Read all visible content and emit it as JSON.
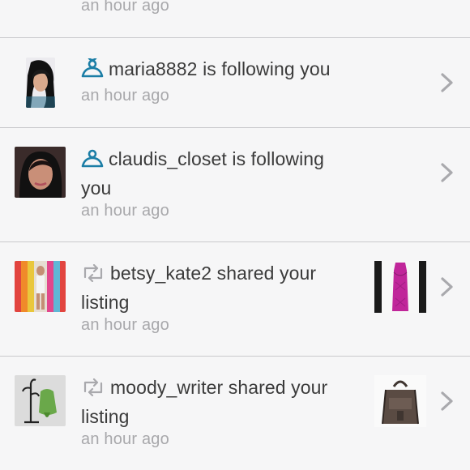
{
  "notifications": [
    {
      "time": "an hour ago"
    },
    {
      "type": "follow",
      "user": "maria8882",
      "text": " is following you",
      "time": "an hour ago"
    },
    {
      "type": "follow",
      "user": "claudis_closet",
      "text": " is following",
      "text2": "you",
      "time": "an hour ago"
    },
    {
      "type": "share",
      "user": "betsy_kate2",
      "text": " shared your",
      "text2": "listing",
      "time": "an hour ago",
      "thumb": "dress-thumbnail"
    },
    {
      "type": "share",
      "user": "moody_writer",
      "text": " shared your",
      "text2": "listing",
      "time": "an hour ago",
      "thumb": "bag-thumbnail"
    }
  ],
  "icons": {
    "follow": "person-icon",
    "share": "share-icon",
    "nav": "chevron-right-icon"
  },
  "colors": {
    "accent": "#1c7ea6",
    "text": "#3b3b3b",
    "muted": "#a8a8ab",
    "divider": "#c9c9cc",
    "background": "#f6f6f7"
  }
}
